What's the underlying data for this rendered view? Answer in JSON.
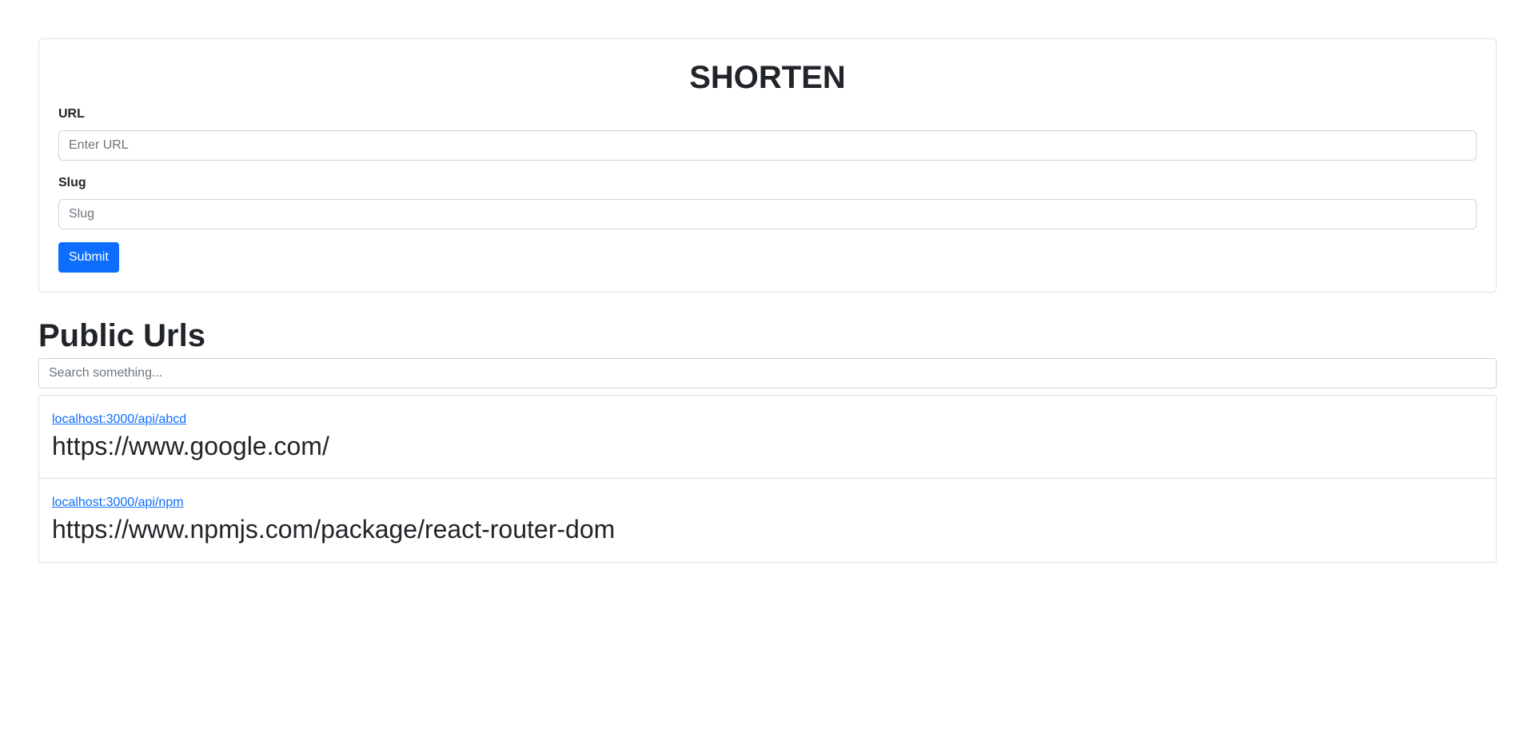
{
  "form": {
    "title": "SHORTEN",
    "url_label": "URL",
    "url_placeholder": "Enter URL",
    "url_value": "",
    "slug_label": "Slug",
    "slug_placeholder": "Slug",
    "slug_value": "",
    "submit_label": "Submit"
  },
  "public": {
    "title": "Public Urls",
    "search_placeholder": "Search something...",
    "search_value": "",
    "items": [
      {
        "short": "localhost:3000/api/abcd",
        "long": "https://www.google.com/"
      },
      {
        "short": "localhost:3000/api/npm",
        "long": "https://www.npmjs.com/package/react-router-dom"
      }
    ]
  },
  "colors": {
    "primary": "#0d6efd",
    "text": "#212529",
    "border": "#dee2e6"
  }
}
